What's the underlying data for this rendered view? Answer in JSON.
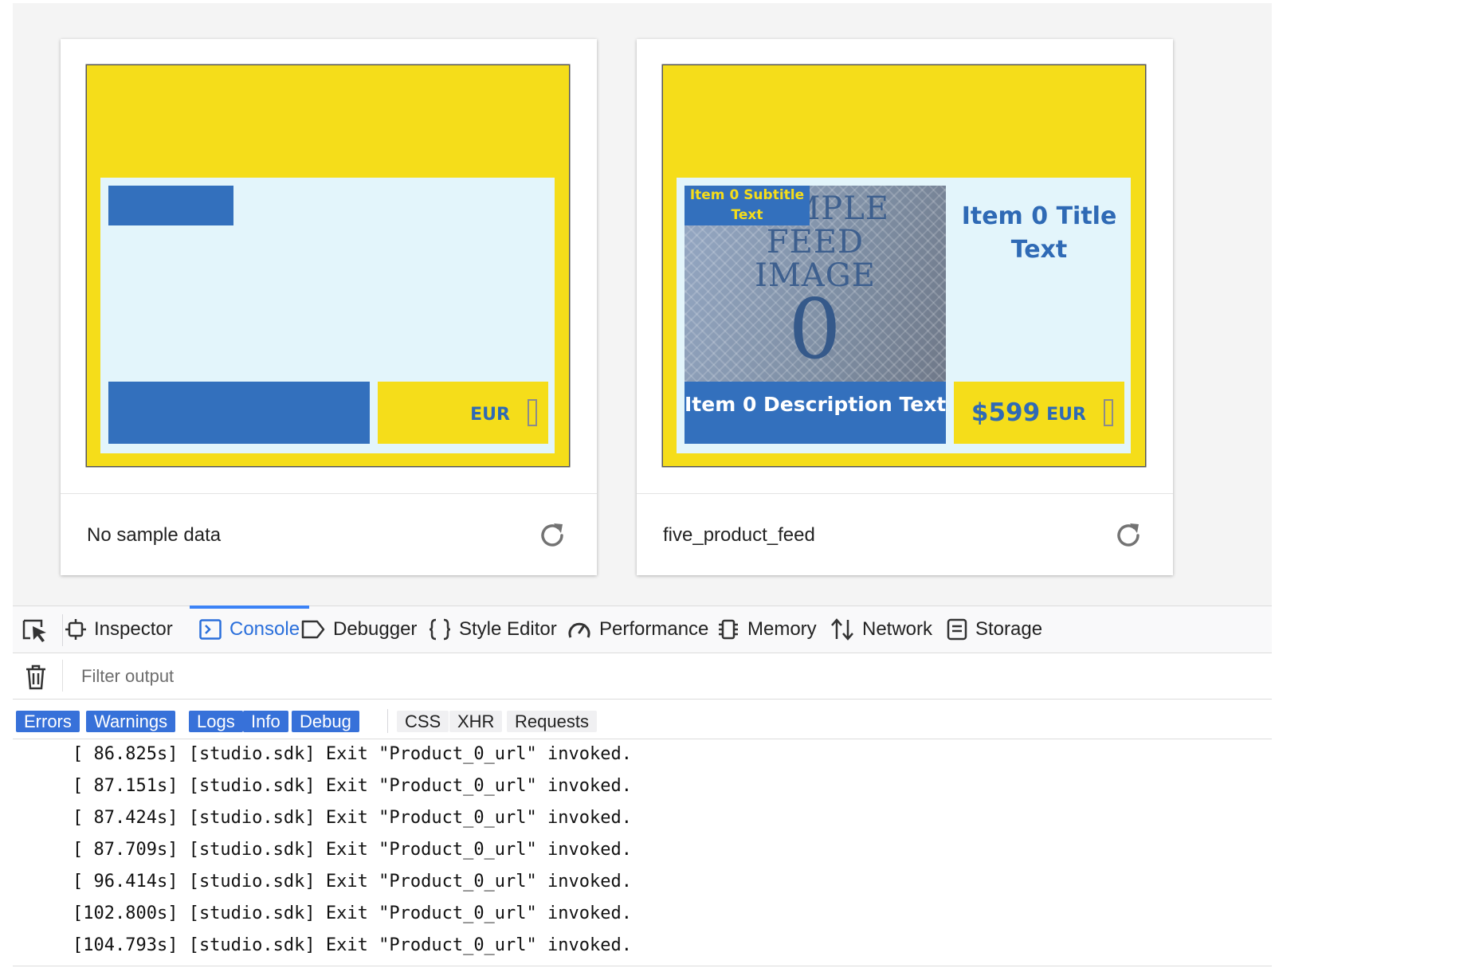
{
  "colors": {
    "banner_yellow": "#f5dd1a",
    "panel_light": "#e3f5fb",
    "brand_blue": "#3370bd",
    "active_tab": "#2a6fdb",
    "chip_active": "#3771d9"
  },
  "cards": [
    {
      "label": "No sample data",
      "currency": "EUR",
      "refresh_icon": "refresh-icon"
    },
    {
      "label": "five_product_feed",
      "subtitle": "Item 0 Subtitle Text",
      "image_text": [
        "SAMPLE",
        "FEED",
        "IMAGE",
        "0"
      ],
      "title": "Item 0 Title Text",
      "description": "Item 0 Description Text",
      "price": "$599",
      "currency": "EUR",
      "refresh_icon": "refresh-icon"
    }
  ],
  "devtools": {
    "tabs": [
      {
        "label": "Inspector",
        "icon": "inspector-icon",
        "active": false
      },
      {
        "label": "Console",
        "icon": "console-icon",
        "active": true
      },
      {
        "label": "Debugger",
        "icon": "debugger-icon",
        "active": false
      },
      {
        "label": "Style Editor",
        "icon": "braces-icon",
        "active": false
      },
      {
        "label": "Performance",
        "icon": "gauge-icon",
        "active": false
      },
      {
        "label": "Memory",
        "icon": "chip-icon",
        "active": false
      },
      {
        "label": "Network",
        "icon": "arrows-icon",
        "active": false
      },
      {
        "label": "Storage",
        "icon": "storage-icon",
        "active": false
      }
    ],
    "filter_placeholder": "Filter output",
    "level_filters": [
      "Errors",
      "Warnings",
      "Logs",
      "Info",
      "Debug"
    ],
    "type_filters": [
      "CSS",
      "XHR",
      "Requests"
    ],
    "log_lines": [
      "[ 86.825s] [studio.sdk] Exit \"Product_0_url\" invoked.",
      "[ 87.151s] [studio.sdk] Exit \"Product_0_url\" invoked.",
      "[ 87.424s] [studio.sdk] Exit \"Product_0_url\" invoked.",
      "[ 87.709s] [studio.sdk] Exit \"Product_0_url\" invoked.",
      "[ 96.414s] [studio.sdk] Exit \"Product_0_url\" invoked.",
      "[102.800s] [studio.sdk] Exit \"Product_0_url\" invoked.",
      "[104.793s] [studio.sdk] Exit \"Product_0_url\" invoked."
    ]
  }
}
